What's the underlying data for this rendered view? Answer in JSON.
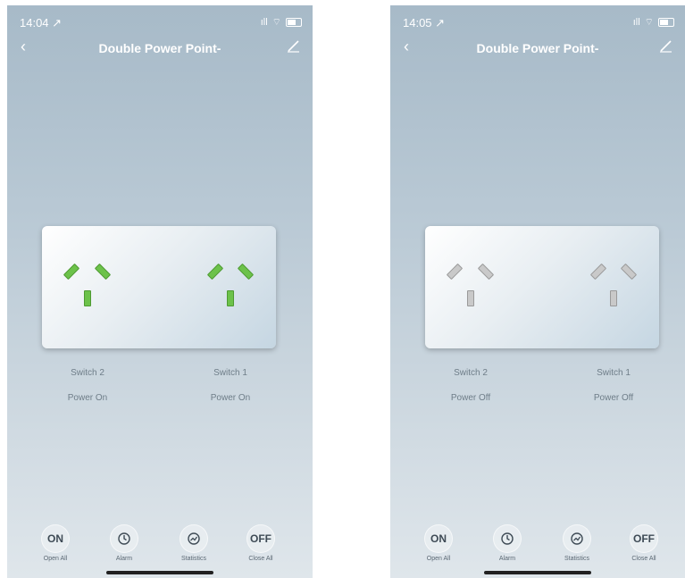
{
  "screens": [
    {
      "status": {
        "time": "14:04 ↗",
        "signal": "ⵗ"
      },
      "title": "Double Power Point-",
      "switches": [
        {
          "label": "Switch 2",
          "state": "Power On"
        },
        {
          "label": "Switch 1",
          "state": "Power On"
        }
      ],
      "toolbar": [
        {
          "icon": "ON",
          "label": "Open All"
        },
        {
          "icon": "clock-icon",
          "label": "Alarm"
        },
        {
          "icon": "chart-icon",
          "label": "Statistics"
        },
        {
          "icon": "OFF",
          "label": "Close All"
        }
      ],
      "power_state": "on"
    },
    {
      "status": {
        "time": "14:05 ↗",
        "signal": "ⵗ"
      },
      "title": "Double Power Point-",
      "switches": [
        {
          "label": "Switch 2",
          "state": "Power Off"
        },
        {
          "label": "Switch 1",
          "state": "Power Off"
        }
      ],
      "toolbar": [
        {
          "icon": "ON",
          "label": "Open All"
        },
        {
          "icon": "clock-icon",
          "label": "Alarm"
        },
        {
          "icon": "chart-icon",
          "label": "Statistics"
        },
        {
          "icon": "OFF",
          "label": "Close All"
        }
      ],
      "power_state": "off"
    }
  ],
  "colors": {
    "pin_on": "#6cc24a",
    "pin_off": "#c9c9c9",
    "text_secondary": "#6e7d88"
  }
}
